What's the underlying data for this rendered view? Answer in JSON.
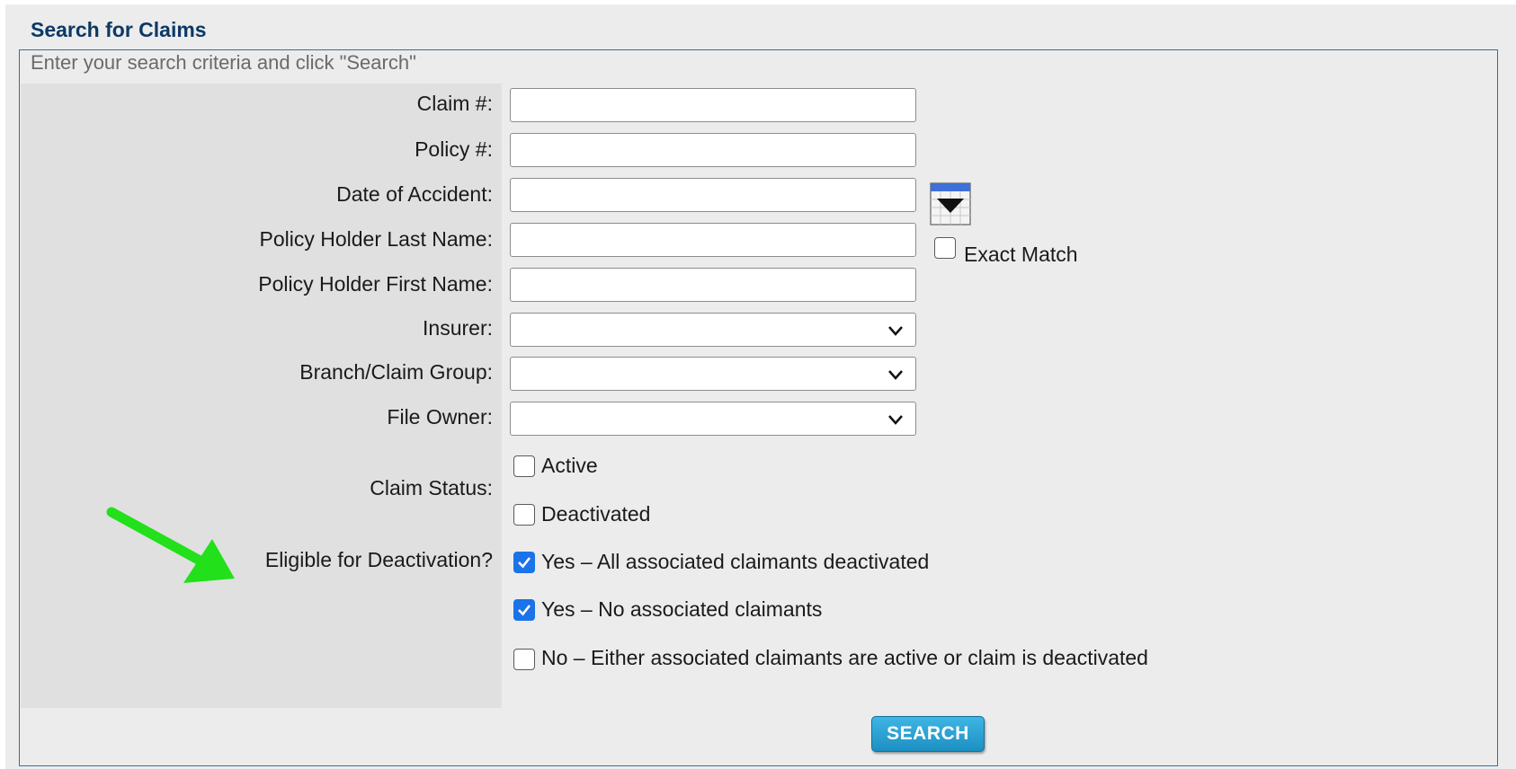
{
  "panel": {
    "title": "Search for Claims",
    "instructions": "Enter your search criteria and click \"Search\""
  },
  "fields": {
    "claim_number_label": "Claim #:",
    "claim_number_value": "",
    "policy_number_label": "Policy #:",
    "policy_number_value": "",
    "date_of_accident_label": "Date of Accident:",
    "date_of_accident_value": "",
    "last_name_label": "Policy Holder Last Name:",
    "last_name_value": "",
    "exact_match_label": "Exact Match",
    "first_name_label": "Policy Holder First Name:",
    "first_name_value": "",
    "insurer_label": "Insurer:",
    "insurer_value": "",
    "branch_label": "Branch/Claim Group:",
    "branch_value": "",
    "file_owner_label": "File Owner:",
    "file_owner_value": ""
  },
  "claim_status": {
    "label": "Claim Status:",
    "options": [
      {
        "label": "Active",
        "checked": false
      },
      {
        "label": "Deactivated",
        "checked": false
      }
    ]
  },
  "eligible": {
    "label": "Eligible for Deactivation?",
    "options": [
      {
        "label": "Yes – All associated claimants deactivated",
        "checked": true
      },
      {
        "label": "Yes – No associated claimants",
        "checked": true
      },
      {
        "label": "No – Either associated claimants are active or claim is deactivated",
        "checked": false
      }
    ]
  },
  "search_button": "SEARCH",
  "colors": {
    "title": "#0c3966",
    "border": "#2e72a0",
    "checkbox_checked": "#1a73e8",
    "button": "#1d8fc2",
    "annotation_arrow": "#22e01a"
  },
  "icons": {
    "calendar": "calendar-dropdown-icon",
    "select_chevron": "chevron-down-icon",
    "annotation": "green-arrow-annotation"
  }
}
